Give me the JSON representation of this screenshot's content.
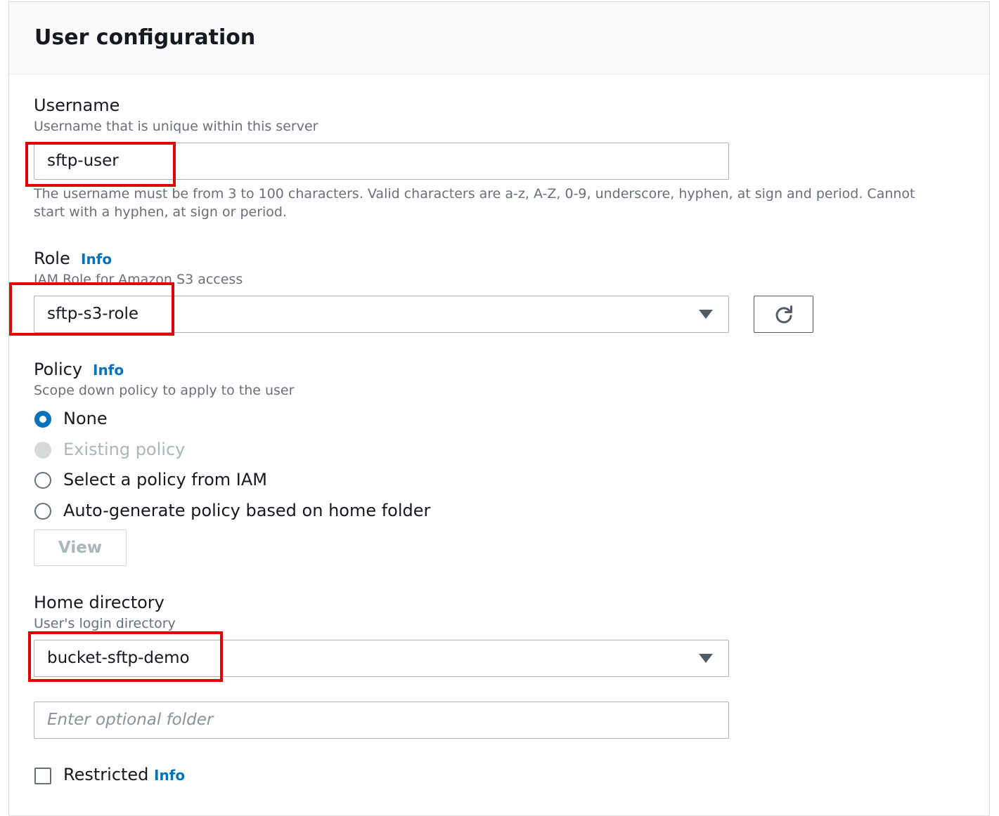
{
  "section": {
    "title": "User configuration"
  },
  "username": {
    "label": "Username",
    "description": "Username that is unique within this server",
    "value": "sftp-user",
    "hint": "The username must be from 3 to 100 characters. Valid characters are a-z, A-Z, 0-9, underscore, hyphen, at sign and period. Cannot start with a hyphen, at sign or period."
  },
  "role": {
    "label": "Role",
    "info": "Info",
    "description": "IAM Role for Amazon S3 access",
    "selected": "sftp-s3-role",
    "refresh_icon": "refresh-icon"
  },
  "policy": {
    "label": "Policy",
    "info": "Info",
    "description": "Scope down policy to apply to the user",
    "options": [
      {
        "label": "None",
        "checked": true,
        "disabled": false
      },
      {
        "label": "Existing policy",
        "checked": false,
        "disabled": true
      },
      {
        "label": "Select a policy from IAM",
        "checked": false,
        "disabled": false
      },
      {
        "label": "Auto-generate policy based on home folder",
        "checked": false,
        "disabled": false
      }
    ],
    "view_button": "View"
  },
  "home_directory": {
    "label": "Home directory",
    "description": "User's login directory",
    "selected": "bucket-sftp-demo",
    "folder_placeholder": "Enter optional folder"
  },
  "restricted": {
    "label": "Restricted",
    "info": "Info",
    "checked": false
  },
  "colors": {
    "accent": "#0073bb",
    "highlight": "#e00000"
  }
}
